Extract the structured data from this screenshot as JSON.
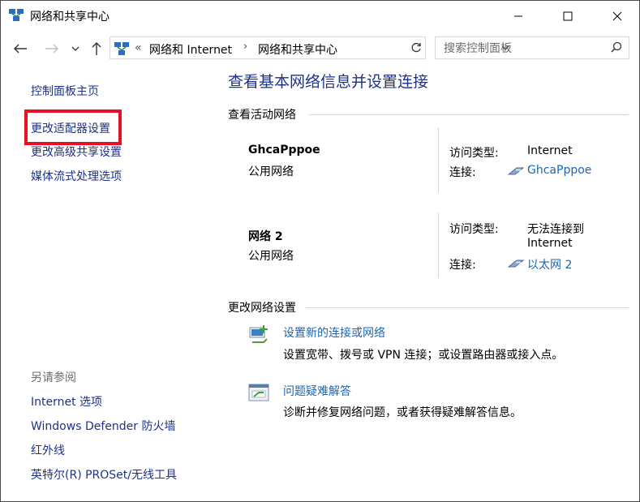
{
  "window": {
    "title": "网络和共享中心"
  },
  "navbar": {
    "address_prefix": "«",
    "breadcrumb": [
      "网络和 Internet",
      "网络和共享中心"
    ],
    "search_placeholder": "搜索控制面板"
  },
  "left_pane": {
    "links": [
      "控制面板主页",
      "更改适配器设置",
      "更改高级共享设置",
      "媒体流式处理选项"
    ],
    "see_also_title": "另请参阅",
    "see_also": [
      "Internet 选项",
      "Windows Defender 防火墙",
      "红外线",
      "英特尔(R) PROSet/无线工具"
    ]
  },
  "main": {
    "heading": "查看基本网络信息并设置连接",
    "active_networks_title": "查看活动网络",
    "networks": [
      {
        "name": "GhcaPppoe",
        "category": "公用网络",
        "access_label": "访问类型:",
        "access_value": "Internet",
        "connection_label": "连接:",
        "connection_value": "GhcaPppoe"
      },
      {
        "name": "网络 2",
        "category": "公用网络",
        "access_label": "访问类型:",
        "access_value_line1": "无法连接到",
        "access_value_line2": "Internet",
        "connection_label": "连接:",
        "connection_value": "以太网 2"
      }
    ],
    "change_settings_title": "更改网络设置",
    "tasks": [
      {
        "title": "设置新的连接或网络",
        "desc": "设置宽带、拨号或 VPN 连接；或设置路由器或接入点。"
      },
      {
        "title": "问题疑难解答",
        "desc": "诊断并修复网络问题，或者获得疑难解答信息。"
      }
    ]
  },
  "colors": {
    "link": "#1e3287",
    "accent_link": "#1a66b3",
    "highlight": "#e81123"
  }
}
